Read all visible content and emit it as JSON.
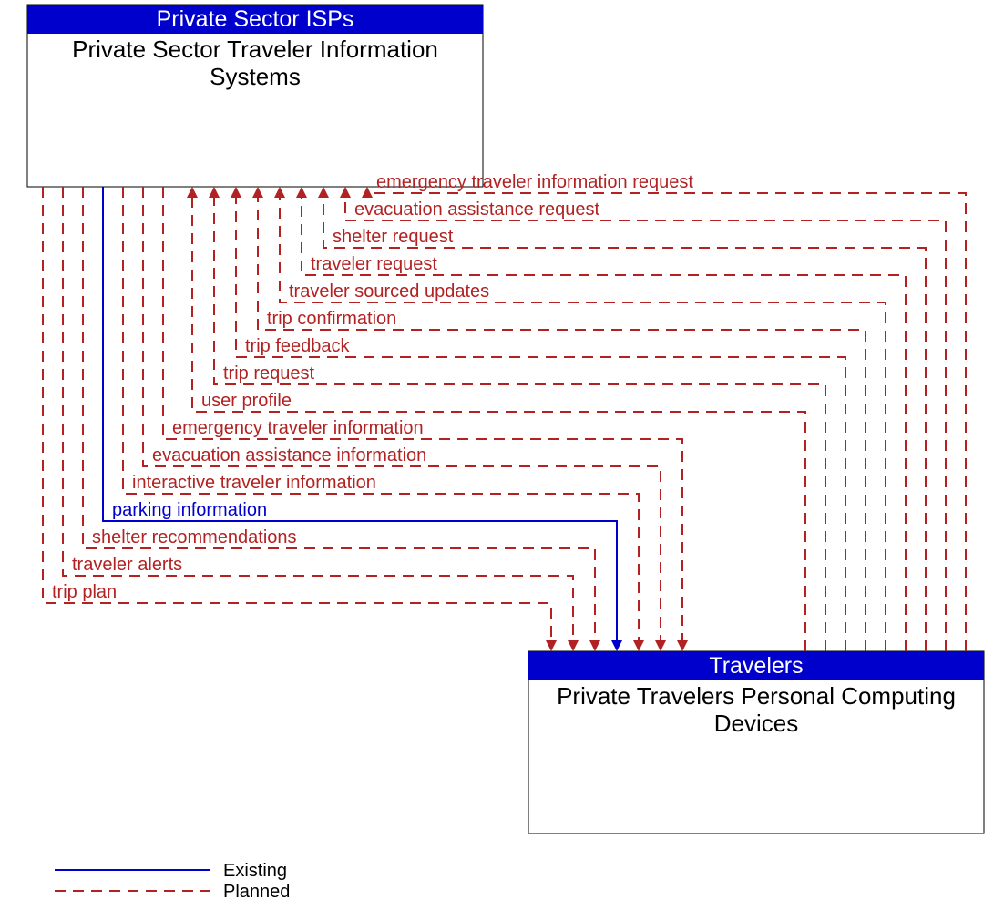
{
  "entities": {
    "top": {
      "header": "Private Sector ISPs",
      "body_line1": "Private Sector Traveler Information",
      "body_line2": "Systems"
    },
    "bottom": {
      "header": "Travelers",
      "body_line1": "Private Travelers Personal Computing",
      "body_line2": "Devices"
    }
  },
  "flows": {
    "to_bottom": [
      {
        "label": "trip plan",
        "status": "planned"
      },
      {
        "label": "traveler alerts",
        "status": "planned"
      },
      {
        "label": "shelter recommendations",
        "status": "planned"
      },
      {
        "label": "parking information",
        "status": "existing"
      },
      {
        "label": "interactive traveler information",
        "status": "planned"
      },
      {
        "label": "evacuation assistance information",
        "status": "planned"
      },
      {
        "label": "emergency traveler information",
        "status": "planned"
      }
    ],
    "to_top": [
      {
        "label": "user profile",
        "status": "planned"
      },
      {
        "label": "trip request",
        "status": "planned"
      },
      {
        "label": "trip feedback",
        "status": "planned"
      },
      {
        "label": "trip confirmation",
        "status": "planned"
      },
      {
        "label": "traveler sourced updates",
        "status": "planned"
      },
      {
        "label": "traveler request",
        "status": "planned"
      },
      {
        "label": "shelter request",
        "status": "planned"
      },
      {
        "label": "evacuation assistance request",
        "status": "planned"
      },
      {
        "label": "emergency traveler information request",
        "status": "planned"
      }
    ]
  },
  "legend": {
    "existing": "Existing",
    "planned": "Planned",
    "colors": {
      "existing": "#0000cc",
      "planned": "#b22222"
    }
  }
}
